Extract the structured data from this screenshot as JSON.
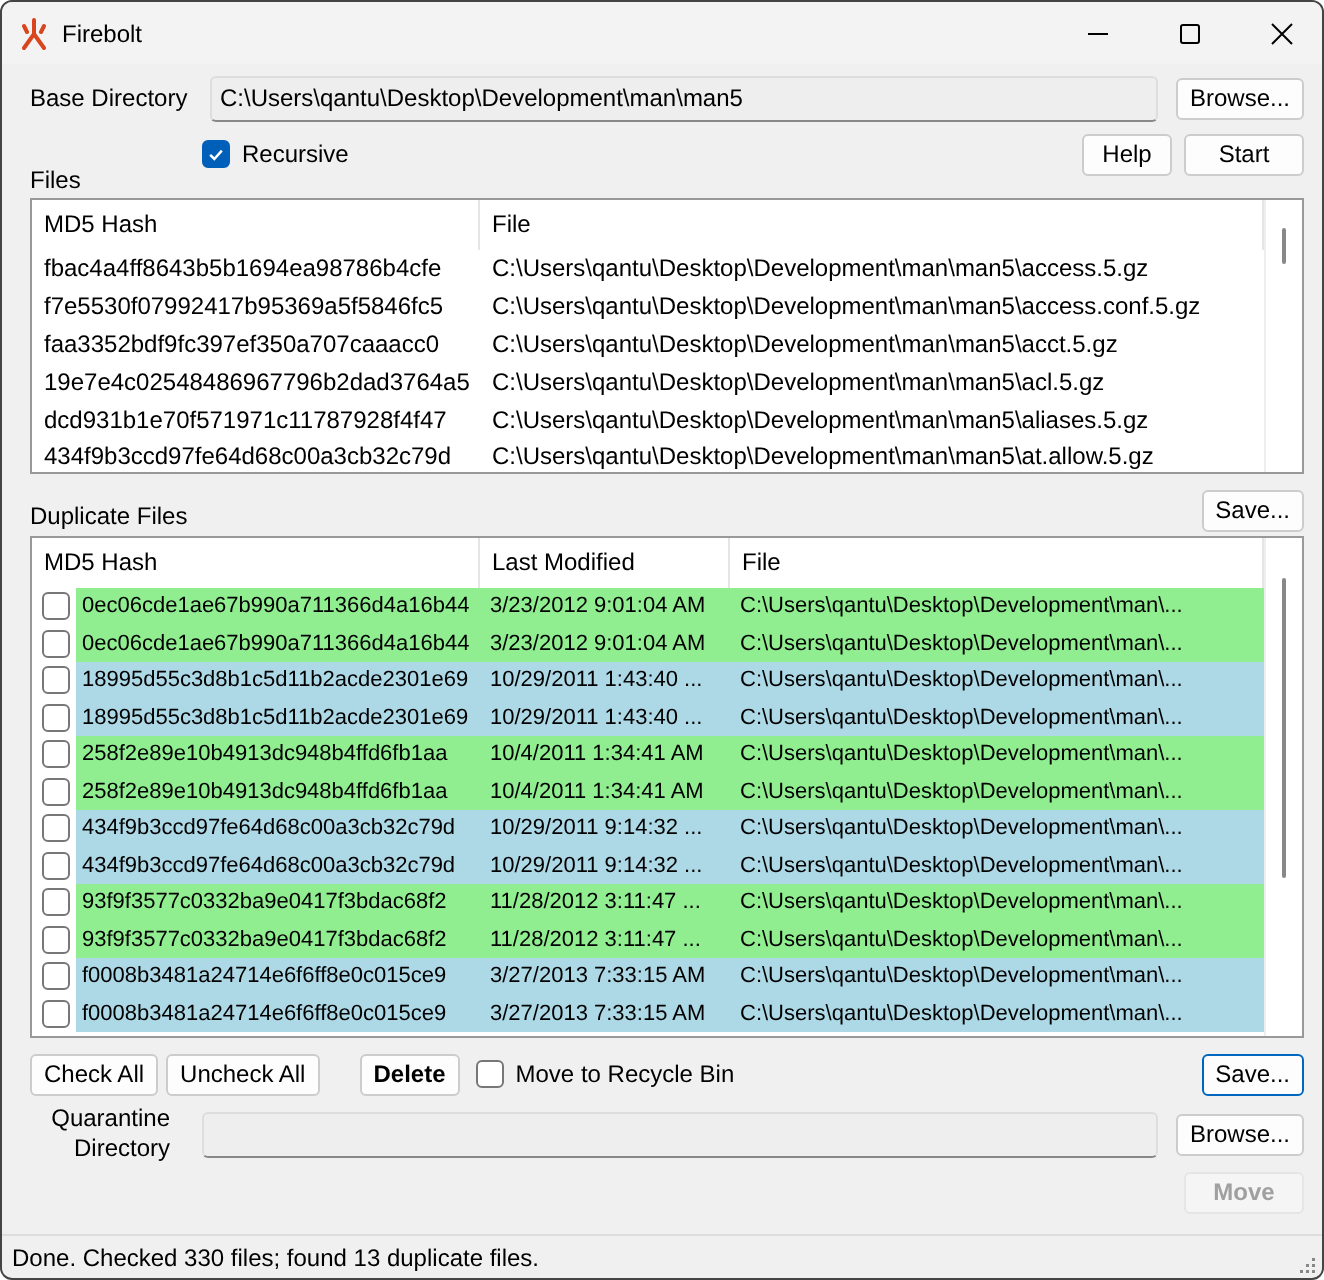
{
  "window": {
    "title": "Firebolt"
  },
  "base_directory": {
    "label": "Base Directory",
    "value": "C:\\Users\\qantu\\Desktop\\Development\\man\\man5",
    "browse_button": "Browse..."
  },
  "recursive": {
    "label": "Recursive",
    "checked": true
  },
  "help_button": "Help",
  "start_button": "Start",
  "files": {
    "label": "Files",
    "columns": [
      "MD5 Hash",
      "File"
    ],
    "rows": [
      {
        "hash": "fbac4a4ff8643b5b1694ea98786b4cfe",
        "file": "C:\\Users\\qantu\\Desktop\\Development\\man\\man5\\access.5.gz"
      },
      {
        "hash": "f7e5530f07992417b95369a5f5846fc5",
        "file": "C:\\Users\\qantu\\Desktop\\Development\\man\\man5\\access.conf.5.gz"
      },
      {
        "hash": "faa3352bdf9fc397ef350a707caaacc0",
        "file": "C:\\Users\\qantu\\Desktop\\Development\\man\\man5\\acct.5.gz"
      },
      {
        "hash": "19e7e4c02548486967796b2dad3764a5",
        "file": "C:\\Users\\qantu\\Desktop\\Development\\man\\man5\\acl.5.gz"
      },
      {
        "hash": "dcd931b1e70f571971c11787928f4f47",
        "file": "C:\\Users\\qantu\\Desktop\\Development\\man\\man5\\aliases.5.gz"
      },
      {
        "hash": "434f9b3ccd97fe64d68c00a3cb32c79d",
        "file": "C:\\Users\\qantu\\Desktop\\Development\\man\\man5\\at.allow.5.gz"
      }
    ]
  },
  "duplicates": {
    "label": "Duplicate Files",
    "save_button": {
      "label": "Save...",
      "focused": false
    },
    "columns": [
      "MD5 Hash",
      "Last Modified",
      "File"
    ],
    "rows": [
      {
        "checked": false,
        "color": "#90ee90",
        "hash": "0ec06cde1ae67b990a711366d4a16b44",
        "modified": "3/23/2012 9:01:04 AM",
        "file": "C:\\Users\\qantu\\Desktop\\Development\\man\\..."
      },
      {
        "checked": false,
        "color": "#90ee90",
        "hash": "0ec06cde1ae67b990a711366d4a16b44",
        "modified": "3/23/2012 9:01:04 AM",
        "file": "C:\\Users\\qantu\\Desktop\\Development\\man\\..."
      },
      {
        "checked": false,
        "color": "#add8e6",
        "hash": "18995d55c3d8b1c5d11b2acde2301e69",
        "modified": "10/29/2011 1:43:40 ...",
        "file": "C:\\Users\\qantu\\Desktop\\Development\\man\\..."
      },
      {
        "checked": false,
        "color": "#add8e6",
        "hash": "18995d55c3d8b1c5d11b2acde2301e69",
        "modified": "10/29/2011 1:43:40 ...",
        "file": "C:\\Users\\qantu\\Desktop\\Development\\man\\..."
      },
      {
        "checked": false,
        "color": "#90ee90",
        "hash": "258f2e89e10b4913dc948b4ffd6fb1aa",
        "modified": "10/4/2011 1:34:41 AM",
        "file": "C:\\Users\\qantu\\Desktop\\Development\\man\\..."
      },
      {
        "checked": false,
        "color": "#90ee90",
        "hash": "258f2e89e10b4913dc948b4ffd6fb1aa",
        "modified": "10/4/2011 1:34:41 AM",
        "file": "C:\\Users\\qantu\\Desktop\\Development\\man\\..."
      },
      {
        "checked": false,
        "color": "#add8e6",
        "hash": "434f9b3ccd97fe64d68c00a3cb32c79d",
        "modified": "10/29/2011 9:14:32 ...",
        "file": "C:\\Users\\qantu\\Desktop\\Development\\man\\..."
      },
      {
        "checked": false,
        "color": "#add8e6",
        "hash": "434f9b3ccd97fe64d68c00a3cb32c79d",
        "modified": "10/29/2011 9:14:32 ...",
        "file": "C:\\Users\\qantu\\Desktop\\Development\\man\\..."
      },
      {
        "checked": false,
        "color": "#90ee90",
        "hash": "93f9f3577c0332ba9e0417f3bdac68f2",
        "modified": "11/28/2012 3:11:47 ...",
        "file": "C:\\Users\\qantu\\Desktop\\Development\\man\\..."
      },
      {
        "checked": false,
        "color": "#90ee90",
        "hash": "93f9f3577c0332ba9e0417f3bdac68f2",
        "modified": "11/28/2012 3:11:47 ...",
        "file": "C:\\Users\\qantu\\Desktop\\Development\\man\\..."
      },
      {
        "checked": false,
        "color": "#add8e6",
        "hash": "f0008b3481a24714e6f6ff8e0c015ce9",
        "modified": "3/27/2013 7:33:15 AM",
        "file": "C:\\Users\\qantu\\Desktop\\Development\\man\\..."
      },
      {
        "checked": false,
        "color": "#add8e6",
        "hash": "f0008b3481a24714e6f6ff8e0c015ce9",
        "modified": "3/27/2013 7:33:15 AM",
        "file": "C:\\Users\\qantu\\Desktop\\Development\\man\\..."
      }
    ]
  },
  "check_all_button": "Check All",
  "uncheck_all_button": "Uncheck All",
  "delete_button": "Delete",
  "recycle_bin": {
    "label": "Move to Recycle Bin",
    "checked": false
  },
  "save_button": {
    "label": "Save...",
    "focused": true
  },
  "quarantine": {
    "label": "Quarantine Directory",
    "browse_button": "Browse..."
  },
  "move_button": {
    "label": "Move",
    "disabled": true
  },
  "status_bar": "Done. Checked 330 files; found 13 duplicate files."
}
